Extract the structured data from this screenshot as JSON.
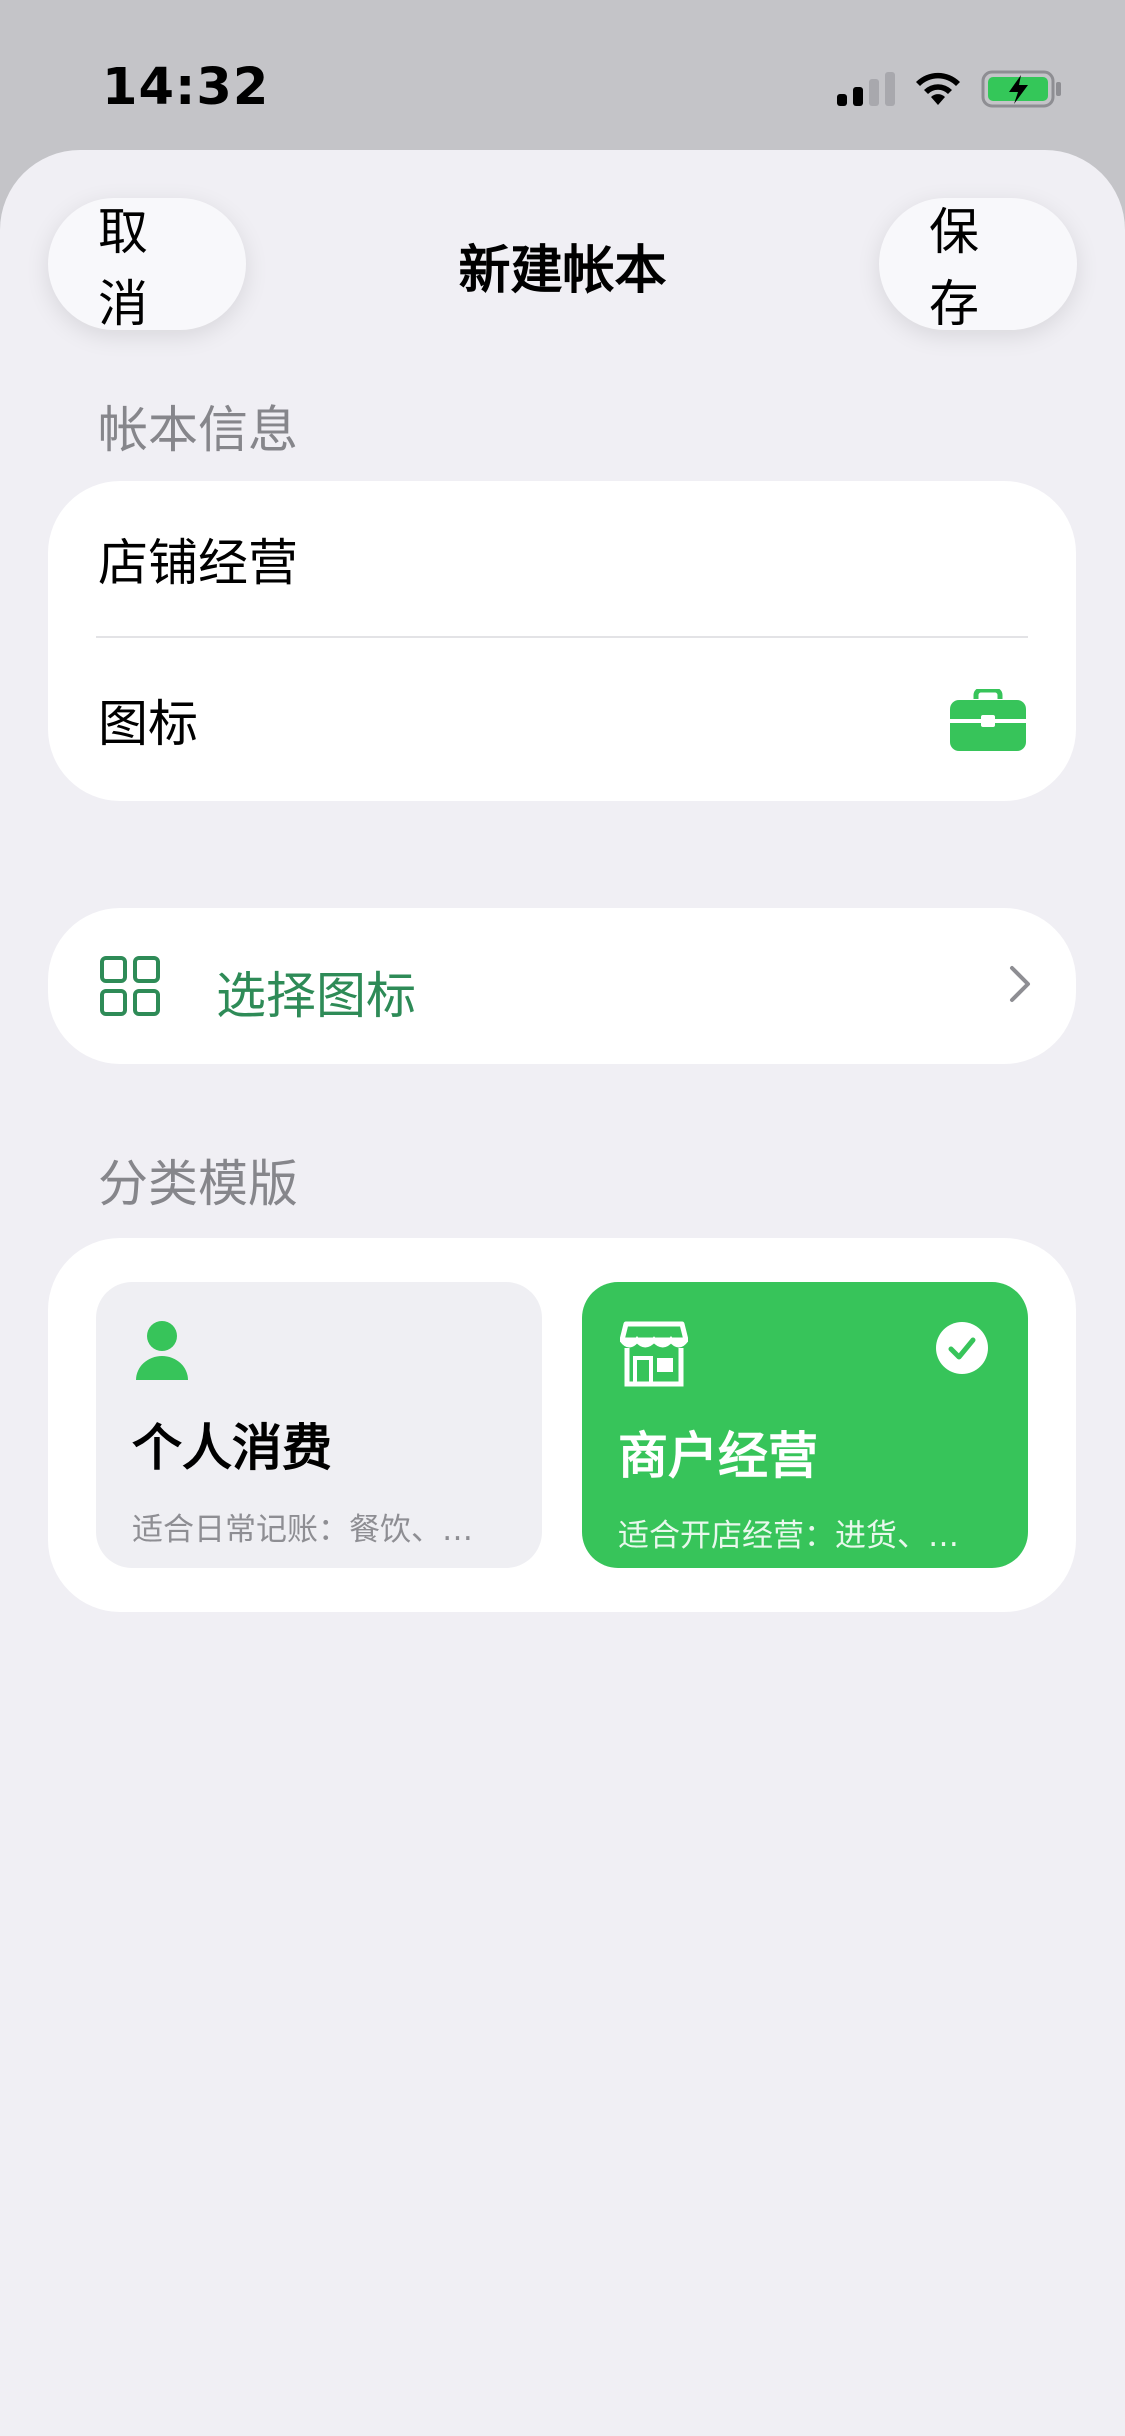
{
  "status_bar": {
    "time": "14:32",
    "icons": [
      "cellular-signal-icon",
      "wifi-icon",
      "battery-charging-icon"
    ]
  },
  "nav": {
    "cancel_label": "取消",
    "title": "新建帐本",
    "save_label": "保存"
  },
  "info_section": {
    "header": "帐本信息",
    "name_value": "店铺经营",
    "icon_row_label": "图标",
    "selected_icon": "briefcase-icon"
  },
  "icon_picker": {
    "label": "选择图标",
    "icon": "grid-icon"
  },
  "templates_section": {
    "header": "分类模版",
    "templates": [
      {
        "title": "个人消费",
        "description": "适合日常记账：餐饮、…",
        "icon": "person-icon",
        "selected": false
      },
      {
        "title": "商户经营",
        "description": "适合开店经营：进货、…",
        "icon": "storefront-icon",
        "selected": true
      }
    ]
  },
  "colors": {
    "accent_green": "#37c45a",
    "link_green": "#2e8b57",
    "background": "#f0eff4",
    "secondary_text": "#86868b"
  }
}
